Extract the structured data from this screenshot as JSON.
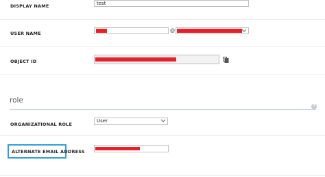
{
  "fields": {
    "display_name": {
      "label": "DISPLAY NAME",
      "value": "test"
    },
    "user_name": {
      "label": "USER NAME",
      "at_symbol": "@"
    },
    "object_id": {
      "label": "OBJECT ID"
    },
    "org_role": {
      "label": "ORGANIZATIONAL ROLE",
      "value": "User"
    },
    "alt_email": {
      "label": "ALTERNATE EMAIL ADDRESS"
    }
  },
  "section": {
    "title": "role",
    "help_glyph": "?"
  },
  "icons": {
    "copy": "copy-icon",
    "dropdown": "chevron-down-icon",
    "help": "help-icon"
  },
  "colors": {
    "redaction": "#e8202a",
    "focus_outline": "#2f9fd8"
  }
}
